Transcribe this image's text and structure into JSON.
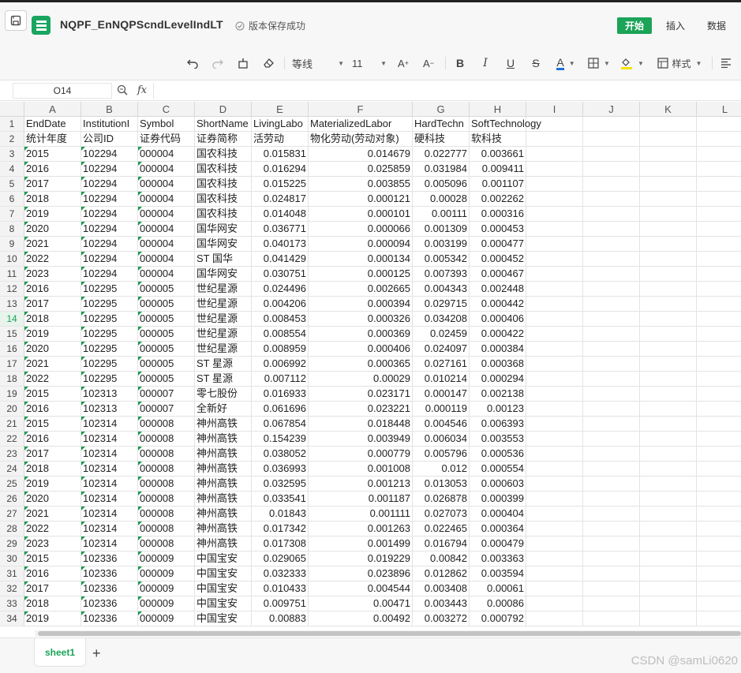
{
  "header": {
    "title": "NQPF_EnNQPScndLevelIndLT",
    "save_status": "版本保存成功",
    "tabs": [
      "开始",
      "插入",
      "数据"
    ]
  },
  "toolbar": {
    "font_name": "等线",
    "font_size": "11",
    "style_label": "样式",
    "icons": [
      "undo-icon",
      "redo-icon",
      "format-painter-icon",
      "eraser-icon",
      "increase-font-icon",
      "decrease-font-icon",
      "bold-icon",
      "italic-icon",
      "underline-icon",
      "strikethrough-icon",
      "font-color-icon",
      "border-icon",
      "fill-color-icon",
      "cell-style-icon",
      "align-icon"
    ],
    "font_color": "#1e6fd9",
    "fill_color": "#f4e300"
  },
  "formula_bar": {
    "cell_ref": "O14",
    "fx": "fx",
    "value": ""
  },
  "grid": {
    "columns": [
      "A",
      "B",
      "C",
      "D",
      "E",
      "F",
      "G",
      "H",
      "I",
      "J",
      "K",
      "L"
    ],
    "active_row": 14,
    "rows": [
      [
        "EndDate",
        "InstitutionI",
        "Symbol",
        "ShortName",
        "LivingLabo",
        "MaterializedLabor",
        "HardTechn",
        "SoftTechnology"
      ],
      [
        "统计年度",
        "公司ID",
        "证券代码",
        "证券简称",
        "活劳动",
        "物化劳动(劳动对象)",
        "硬科技",
        "软科技"
      ],
      [
        "2015",
        "102294",
        "000004",
        "国农科技",
        "0.015831",
        "0.014679",
        "0.022777",
        "0.003661"
      ],
      [
        "2016",
        "102294",
        "000004",
        "国农科技",
        "0.016294",
        "0.025859",
        "0.031984",
        "0.009411"
      ],
      [
        "2017",
        "102294",
        "000004",
        "国农科技",
        "0.015225",
        "0.003855",
        "0.005096",
        "0.001107"
      ],
      [
        "2018",
        "102294",
        "000004",
        "国农科技",
        "0.024817",
        "0.000121",
        "0.00028",
        "0.002262"
      ],
      [
        "2019",
        "102294",
        "000004",
        "国农科技",
        "0.014048",
        "0.000101",
        "0.00111",
        "0.000316"
      ],
      [
        "2020",
        "102294",
        "000004",
        "国华网安",
        "0.036771",
        "0.000066",
        "0.001309",
        "0.000453"
      ],
      [
        "2021",
        "102294",
        "000004",
        "国华网安",
        "0.040173",
        "0.000094",
        "0.003199",
        "0.000477"
      ],
      [
        "2022",
        "102294",
        "000004",
        "ST 国华",
        "0.041429",
        "0.000134",
        "0.005342",
        "0.000452"
      ],
      [
        "2023",
        "102294",
        "000004",
        "国华网安",
        "0.030751",
        "0.000125",
        "0.007393",
        "0.000467"
      ],
      [
        "2016",
        "102295",
        "000005",
        "世纪星源",
        "0.024496",
        "0.002665",
        "0.004343",
        "0.002448"
      ],
      [
        "2017",
        "102295",
        "000005",
        "世纪星源",
        "0.004206",
        "0.000394",
        "0.029715",
        "0.000442"
      ],
      [
        "2018",
        "102295",
        "000005",
        "世纪星源",
        "0.008453",
        "0.000326",
        "0.034208",
        "0.000406"
      ],
      [
        "2019",
        "102295",
        "000005",
        "世纪星源",
        "0.008554",
        "0.000369",
        "0.02459",
        "0.000422"
      ],
      [
        "2020",
        "102295",
        "000005",
        "世纪星源",
        "0.008959",
        "0.000406",
        "0.024097",
        "0.000384"
      ],
      [
        "2021",
        "102295",
        "000005",
        "ST 星源",
        "0.006992",
        "0.000365",
        "0.027161",
        "0.000368"
      ],
      [
        "2022",
        "102295",
        "000005",
        "ST 星源",
        "0.007112",
        "0.00029",
        "0.010214",
        "0.000294"
      ],
      [
        "2015",
        "102313",
        "000007",
        "零七股份",
        "0.016933",
        "0.023171",
        "0.000147",
        "0.002138"
      ],
      [
        "2016",
        "102313",
        "000007",
        "全新好",
        "0.061696",
        "0.023221",
        "0.000119",
        "0.00123"
      ],
      [
        "2015",
        "102314",
        "000008",
        "神州高铁",
        "0.067854",
        "0.018448",
        "0.004546",
        "0.006393"
      ],
      [
        "2016",
        "102314",
        "000008",
        "神州高铁",
        "0.154239",
        "0.003949",
        "0.006034",
        "0.003553"
      ],
      [
        "2017",
        "102314",
        "000008",
        "神州高铁",
        "0.038052",
        "0.000779",
        "0.005796",
        "0.000536"
      ],
      [
        "2018",
        "102314",
        "000008",
        "神州高铁",
        "0.036993",
        "0.001008",
        "0.012",
        "0.000554"
      ],
      [
        "2019",
        "102314",
        "000008",
        "神州高铁",
        "0.032595",
        "0.001213",
        "0.013053",
        "0.000603"
      ],
      [
        "2020",
        "102314",
        "000008",
        "神州高铁",
        "0.033541",
        "0.001187",
        "0.026878",
        "0.000399"
      ],
      [
        "2021",
        "102314",
        "000008",
        "神州高铁",
        "0.01843",
        "0.001111",
        "0.027073",
        "0.000404"
      ],
      [
        "2022",
        "102314",
        "000008",
        "神州高铁",
        "0.017342",
        "0.001263",
        "0.022465",
        "0.000364"
      ],
      [
        "2023",
        "102314",
        "000008",
        "神州高铁",
        "0.017308",
        "0.001499",
        "0.016794",
        "0.000479"
      ],
      [
        "2015",
        "102336",
        "000009",
        "中国宝安",
        "0.029065",
        "0.019229",
        "0.00842",
        "0.003363"
      ],
      [
        "2016",
        "102336",
        "000009",
        "中国宝安",
        "0.032333",
        "0.023896",
        "0.012862",
        "0.003594"
      ],
      [
        "2017",
        "102336",
        "000009",
        "中国宝安",
        "0.010433",
        "0.004544",
        "0.003408",
        "0.00061"
      ],
      [
        "2018",
        "102336",
        "000009",
        "中国宝安",
        "0.009751",
        "0.00471",
        "0.003443",
        "0.00086"
      ],
      [
        "2019",
        "102336",
        "000009",
        "中国宝安",
        "0.00883",
        "0.00492",
        "0.003272",
        "0.000792"
      ]
    ]
  },
  "sheets": [
    "sheet1"
  ],
  "watermark": "CSDN @samLi0620"
}
